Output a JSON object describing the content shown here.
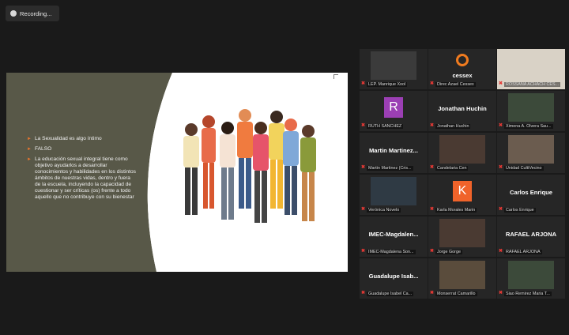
{
  "recording": {
    "label": "Recording..."
  },
  "slide": {
    "bullets": [
      "La Sexualidad es algo íntimo",
      "FALSO",
      "La educación sexual integral tiene como objetivo ayudarlos a desarrollar conocimientos y habilidades en los distintos ámbitos de nuestras vidas, dentro y fuera de la escuela, incluyendo la capacidad de cuestionar y ser críticas (os) frente a todo aquello que no contribuye con su bienestar"
    ]
  },
  "participants": [
    {
      "big_name": "",
      "caption": "LEP. Manrique Xool",
      "kind": "video"
    },
    {
      "big_name": "",
      "caption": "Direc Azael Cessex",
      "kind": "logo",
      "logo_text": "cessex"
    },
    {
      "big_name": "",
      "caption": "ROSSANA ACHACH CES...",
      "kind": "video",
      "active": true
    },
    {
      "big_name": "",
      "caption": "RUTH SANCHEZ",
      "kind": "avatar",
      "avatar_letter": "R"
    },
    {
      "big_name": "Jonathan Huchin",
      "caption": "Jonathan Huchin",
      "kind": "name"
    },
    {
      "big_name": "",
      "caption": "Ximena A. Olvera Sau...",
      "kind": "video"
    },
    {
      "big_name": "Martin Martinez...",
      "caption": "Martin Martinez (Cris...",
      "kind": "name"
    },
    {
      "big_name": "",
      "caption": "Candelaria Cen",
      "kind": "video"
    },
    {
      "big_name": "",
      "caption": "Unidad CultiVecino",
      "kind": "video"
    },
    {
      "big_name": "",
      "caption": "Verónica Novelo",
      "kind": "video"
    },
    {
      "big_name": "",
      "caption": "Karla Morales Marin",
      "kind": "avatar",
      "avatar_letter": "K"
    },
    {
      "big_name": "Carlos Enrique",
      "caption": "Carlos Enrique",
      "kind": "name"
    },
    {
      "big_name": "IMEC-Magdalen...",
      "caption": "IMEC-Magdalena Son...",
      "kind": "name"
    },
    {
      "big_name": "",
      "caption": "Jorge Gorge",
      "kind": "video"
    },
    {
      "big_name": "RAFAEL ARJONA",
      "caption": "RAFAEL ARJONA",
      "kind": "name"
    },
    {
      "big_name": "Guadalupe Isab...",
      "caption": "Guadalupe Isabel Ca...",
      "kind": "name"
    },
    {
      "big_name": "",
      "caption": "Monserrat Camarillo",
      "kind": "video"
    },
    {
      "big_name": "",
      "caption": "Siao Remirez Maria T...",
      "kind": "video"
    }
  ],
  "colors": {
    "mic_muted": "#e53935",
    "active_border": "#c6d21f",
    "slide_dark": "#585848",
    "slide_accent": "#e8752e"
  }
}
